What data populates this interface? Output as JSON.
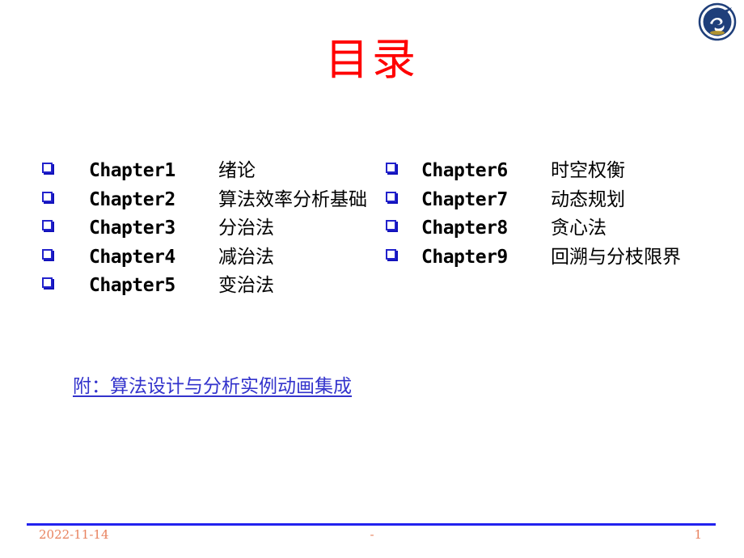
{
  "slide": {
    "title": "目录",
    "title_color": "#FF0000",
    "background_color": "#FFFFFF"
  },
  "logo": {
    "name": "university-emblem",
    "ring_color": "#1F3F7A",
    "mark_color": "#FFFFFF"
  },
  "toc": {
    "bullet_color": "#2222CC",
    "left_column": [
      {
        "chapter": "Chapter1",
        "name": "绪论"
      },
      {
        "chapter": "Chapter2",
        "name": "算法效率分析基础"
      },
      {
        "chapter": "Chapter3",
        "name": "分治法"
      },
      {
        "chapter": "Chapter4",
        "name": "减治法"
      },
      {
        "chapter": "Chapter5",
        "name": "变治法"
      }
    ],
    "right_column": [
      {
        "chapter": "Chapter6",
        "name": "时空权衡"
      },
      {
        "chapter": "Chapter7",
        "name": "动态规划"
      },
      {
        "chapter": "Chapter8",
        "name": "贪心法"
      },
      {
        "chapter": "Chapter9",
        "name": "回溯与分枝限界"
      }
    ]
  },
  "attachment_link": {
    "label": "附：算法设计与分析实例动画集成",
    "color": "#3333CC"
  },
  "footer": {
    "date": "2022-11-14",
    "center": "-",
    "page_number": "1",
    "text_color": "#E8825E",
    "rule_color": "#2222EE"
  }
}
